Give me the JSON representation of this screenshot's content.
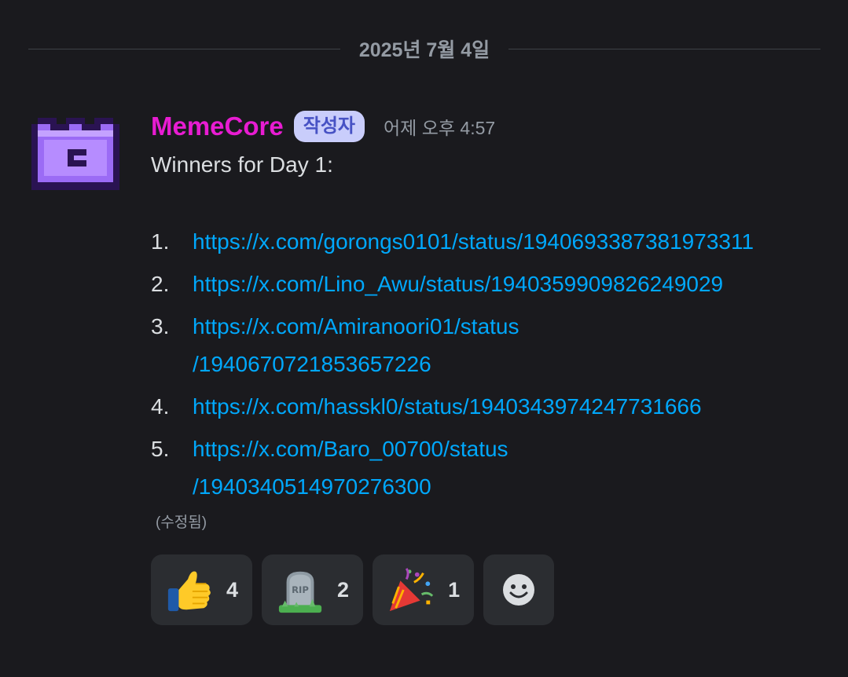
{
  "date_divider": "2025년 7월 4일",
  "message": {
    "username": "MemeCore",
    "username_color": "#e81cd2",
    "badge": "작성자",
    "timestamp": "어제 오후 4:57",
    "intro": "Winners for Day 1:",
    "list": [
      {
        "num": "1.",
        "lines": [
          "https://x.com/gorongs0101/status/1940693387381973311"
        ]
      },
      {
        "num": "2.",
        "lines": [
          "https://x.com/Lino_Awu/status/1940359909826249029"
        ]
      },
      {
        "num": "3.",
        "lines": [
          "https://x.com/Amiranoori01/status",
          "/1940670721853657226"
        ]
      },
      {
        "num": "4.",
        "lines": [
          "https://x.com/hasskl0/status/1940343974247731666"
        ]
      },
      {
        "num": "5.",
        "lines": [
          "https://x.com/Baro_00700/status",
          "/1940340514970276300"
        ]
      }
    ],
    "edited": "(수정됨)"
  },
  "reactions": [
    {
      "icon": "thumbs-up-icon",
      "count": "4"
    },
    {
      "icon": "headstone-rip-icon",
      "count": "2"
    },
    {
      "icon": "party-popper-icon",
      "count": "1"
    }
  ],
  "add_reaction_icon": "smiley-face-icon",
  "colors": {
    "background": "#1a1a1e",
    "link": "#00a8fc",
    "badge_bg": "#c9cdfb",
    "badge_text": "#4752c4"
  }
}
